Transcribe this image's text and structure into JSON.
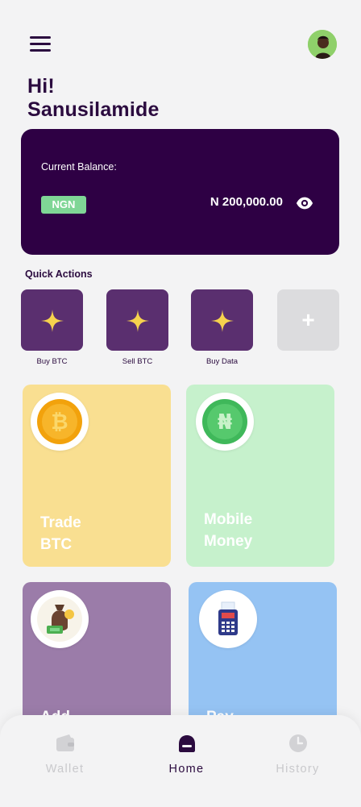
{
  "header": {
    "menu_icon": "hamburger-menu-icon",
    "avatar_icon": "user-avatar"
  },
  "greeting": {
    "line1": "Hi!",
    "name": "Sanusilamide"
  },
  "balance": {
    "label": "Current Balance:",
    "currency": "NGN",
    "amount": "N 200,000.00",
    "toggle_icon": "eye-icon"
  },
  "quick_actions": {
    "title": "Quick Actions",
    "items": [
      {
        "label": "Buy BTC",
        "icon": "sparkle-icon"
      },
      {
        "label": "Sell BTC",
        "icon": "sparkle-icon"
      },
      {
        "label": "Buy Data",
        "icon": "sparkle-icon"
      },
      {
        "label": "+",
        "icon": "plus-icon"
      }
    ]
  },
  "services": [
    {
      "title_line1": "Trade",
      "title_line2": "BTC",
      "icon": "bitcoin-coin-icon",
      "color": "#f9df91"
    },
    {
      "title_line1": "Mobile",
      "title_line2": "Money",
      "icon": "naira-coin-icon",
      "color": "#c6f1cc"
    },
    {
      "title_line1": "Add",
      "title_line2": "",
      "icon": "money-bag-icon",
      "color": "#9b7ca9"
    },
    {
      "title_line1": "Pay",
      "title_line2": "",
      "icon": "pos-terminal-icon",
      "color": "#95c3f3"
    }
  ],
  "bottom_nav": [
    {
      "label": "Wallet",
      "icon": "wallet-icon",
      "active": false
    },
    {
      "label": "Home",
      "icon": "home-icon",
      "active": true
    },
    {
      "label": "History",
      "icon": "clock-icon",
      "active": false
    }
  ],
  "colors": {
    "primary_dark": "#2e0044",
    "tile_purple": "#5a2f6f",
    "accent_green": "#7fd696",
    "sparkle_yellow": "#f6d24d"
  }
}
